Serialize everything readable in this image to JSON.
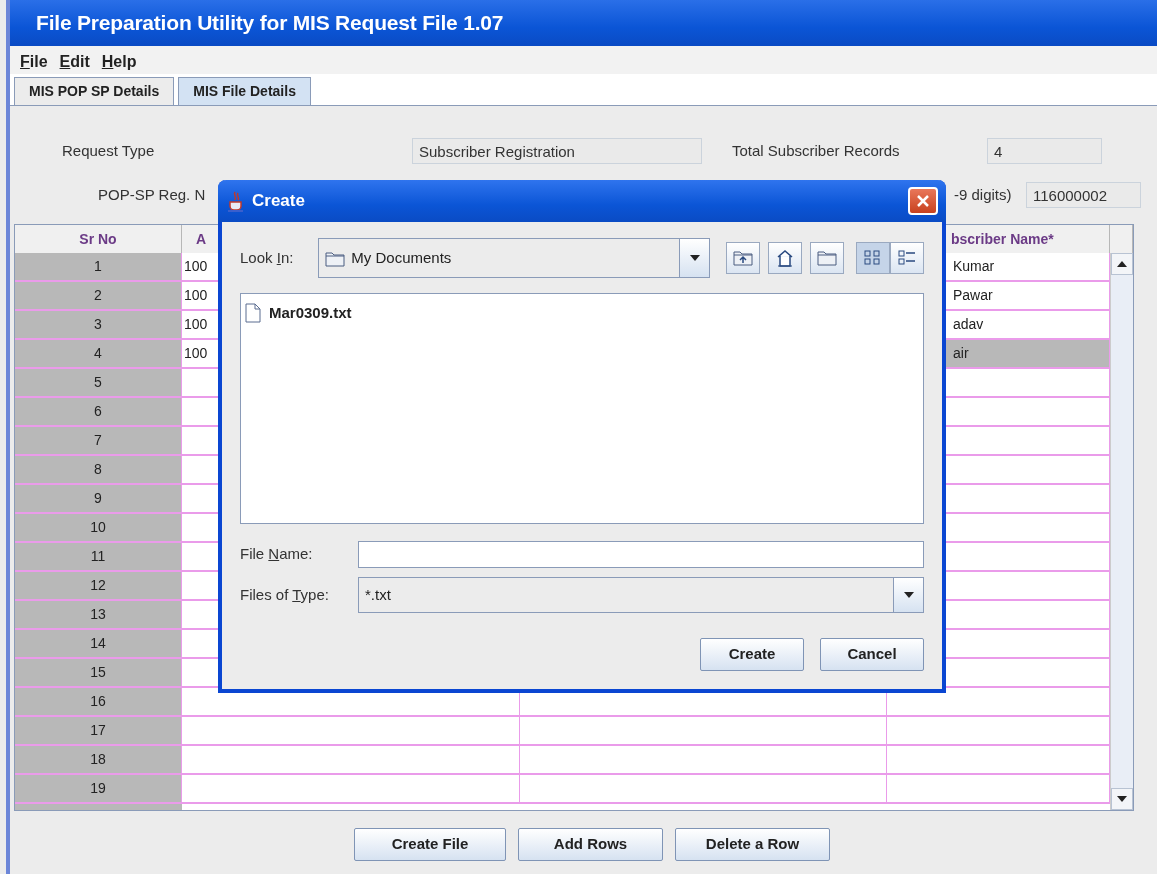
{
  "window": {
    "title": "File Preparation Utility for MIS Request File 1.07"
  },
  "menu": [
    {
      "key": "F",
      "rest": "ile"
    },
    {
      "key": "E",
      "rest": "dit"
    },
    {
      "key": "H",
      "rest": "elp"
    }
  ],
  "tabs": [
    {
      "label": "MIS POP SP Details",
      "selected": false
    },
    {
      "label": "MIS File Details",
      "selected": true
    }
  ],
  "form": {
    "request_type_label": "Request Type",
    "request_type_value": "Subscriber Registration",
    "total_label": "Total Subscriber Records",
    "total_value": "4",
    "pop_sp_label": "POP-SP Reg. N",
    "digits_label": "-9 digits)",
    "pop_sp_value": "116000002"
  },
  "table": {
    "columns": [
      "Sr No",
      "A",
      "bscriber Name*"
    ],
    "rows": [
      {
        "sr": "1",
        "column_2": "100",
        "name": "Kumar",
        "selected": false
      },
      {
        "sr": "2",
        "column_2": "100",
        "name": "Pawar",
        "selected": false
      },
      {
        "sr": "3",
        "column_2": "100",
        "name": "adav",
        "selected": false
      },
      {
        "sr": "4",
        "column_2": "100",
        "name": "air",
        "selected": true
      },
      {
        "sr": "5"
      },
      {
        "sr": "6"
      },
      {
        "sr": "7"
      },
      {
        "sr": "8"
      },
      {
        "sr": "9"
      },
      {
        "sr": "10"
      },
      {
        "sr": "11"
      },
      {
        "sr": "12"
      },
      {
        "sr": "13"
      },
      {
        "sr": "14"
      },
      {
        "sr": "15"
      },
      {
        "sr": "16"
      },
      {
        "sr": "17"
      },
      {
        "sr": "18"
      },
      {
        "sr": "19"
      }
    ]
  },
  "buttons": [
    "Create File",
    "Add Rows",
    "Delete a Row"
  ],
  "dialog": {
    "title": "Create",
    "look_in_label": {
      "pre": "Look ",
      "key": "I",
      "rest": "n:"
    },
    "look_in_value": "My Documents",
    "toolbar": [
      {
        "kind": "up",
        "selected": false
      },
      {
        "kind": "home",
        "selected": false
      },
      {
        "kind": "new-folder",
        "selected": false
      },
      {
        "kind": "list",
        "selected": true
      },
      {
        "kind": "details",
        "selected": false
      }
    ],
    "files": [
      "Mar0309.txt"
    ],
    "file_name_label": {
      "pre": "File ",
      "key": "N",
      "rest": "ame:"
    },
    "file_type_label": {
      "pre": "Files of ",
      "key": "T",
      "rest": "ype:"
    },
    "file_type_value": "*.txt",
    "buttons": [
      "Create",
      "Cancel"
    ]
  }
}
